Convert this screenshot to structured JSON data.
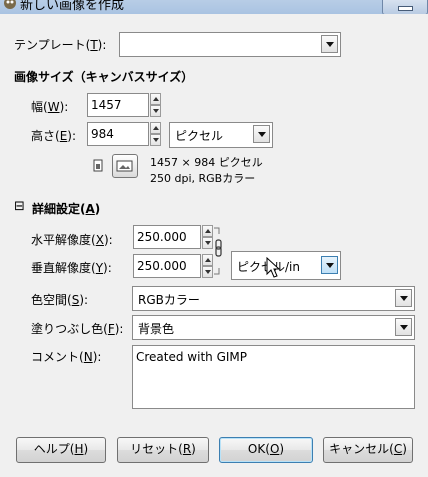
{
  "window": {
    "title": "新しい画像を作成"
  },
  "template": {
    "label": "テンプレート",
    "accel": "T",
    "value": ""
  },
  "image_size": {
    "heading": "画像サイズ（キャンバスサイズ）",
    "width_label": "幅",
    "width_accel": "W",
    "width_value": "1457",
    "height_label": "高さ",
    "height_accel": "E",
    "height_value": "984",
    "unit": "ピクセル",
    "info_line1": "1457 × 984 ピクセル",
    "info_line2": "250 dpi, RGBカラー"
  },
  "advanced": {
    "heading": "詳細設定",
    "accel": "A",
    "toggle_glyph": "⊟",
    "xres_label": "水平解像度",
    "xres_accel": "X",
    "xres_value": "250.000",
    "yres_label": "垂直解像度",
    "yres_accel": "Y",
    "yres_value": "250.000",
    "res_unit": "ピクセル/in",
    "colorspace_label": "色空間",
    "colorspace_accel": "S",
    "colorspace_value": "RGBカラー",
    "fill_label": "塗りつぶし色",
    "fill_accel": "F",
    "fill_value": "背景色",
    "comment_label": "コメント",
    "comment_accel": "N",
    "comment_value": "Created with GIMP"
  },
  "buttons": {
    "help": "ヘルプ",
    "help_accel": "H",
    "reset": "リセット",
    "reset_accel": "R",
    "ok": "OK",
    "ok_accel": "O",
    "cancel": "キャンセル",
    "cancel_accel": "C"
  }
}
